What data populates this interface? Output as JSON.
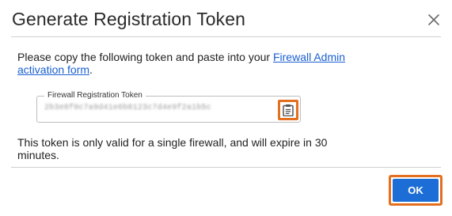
{
  "dialog": {
    "title": "Generate Registration Token",
    "close_icon": "close-icon"
  },
  "intro": {
    "text": "Please copy the following token and paste into your ",
    "link": "Firewall Admin activation form",
    "suffix": "."
  },
  "token": {
    "label": "Firewall Registration Token",
    "value": "2b3e8f0c7a9d41e6b8123c7d4e9f2a1b5c",
    "copy_icon": "clipboard-icon"
  },
  "note": "This token is only valid for a single firewall, and will expire in 30 minutes.",
  "actions": {
    "ok_label": "OK"
  },
  "colors": {
    "accent": "#1c6ed6",
    "highlight": "#e46f1e",
    "link": "#1a5fd1"
  }
}
